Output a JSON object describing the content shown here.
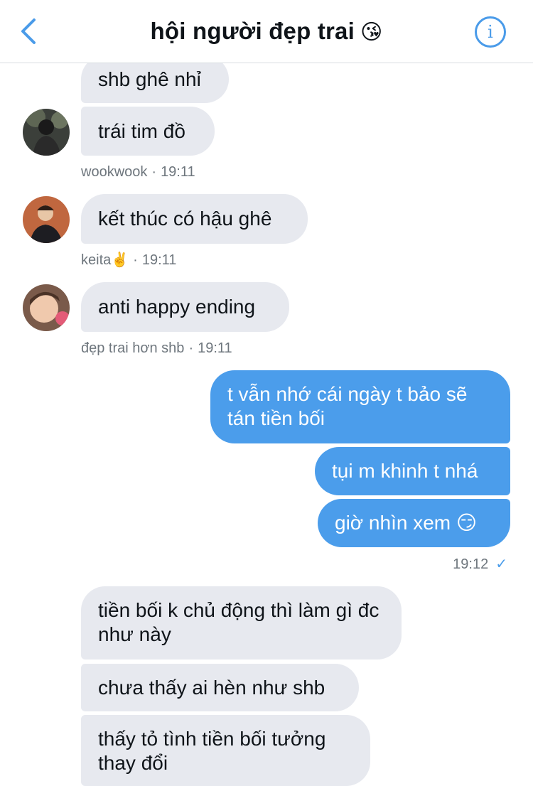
{
  "header": {
    "title": "hội người đẹp trai",
    "title_emoji": "😘",
    "back_icon": "chevron-left-icon",
    "info_icon": "info-icon",
    "accent_color": "#4a9be9"
  },
  "messages": [
    {
      "text": "shb ghê nhỉ"
    },
    {
      "text": "trái tim đồ"
    },
    {
      "text": "kết thúc có hậu ghê"
    },
    {
      "text": "anti happy ending"
    },
    {
      "text": "t vẫn nhớ cái ngày t bảo sẽ tán tiền bối"
    },
    {
      "text": "tụi m khinh t nhá"
    },
    {
      "text": "giờ nhìn xem 😏"
    },
    {
      "text": "tiền bối k chủ động thì làm gì đc như này"
    },
    {
      "text": "chưa thấy ai hèn như shb"
    },
    {
      "text": "thấy tỏ tình tiền bối tưởng thay đổi"
    }
  ],
  "meta": [
    {
      "sender": "wookwook",
      "sep": "·",
      "time": "19:11"
    },
    {
      "sender": "keita✌️",
      "sep": "·",
      "time": "19:11"
    },
    {
      "sender": "đẹp trai hơn shb",
      "sep": "·",
      "time": "19:11"
    },
    {
      "time": "19:12",
      "status_icon": "checkmark-icon"
    }
  ],
  "colors": {
    "incoming_bubble": "#e7e9ef",
    "outgoing_bubble": "#4b9deb",
    "meta_text": "#6e767d"
  }
}
